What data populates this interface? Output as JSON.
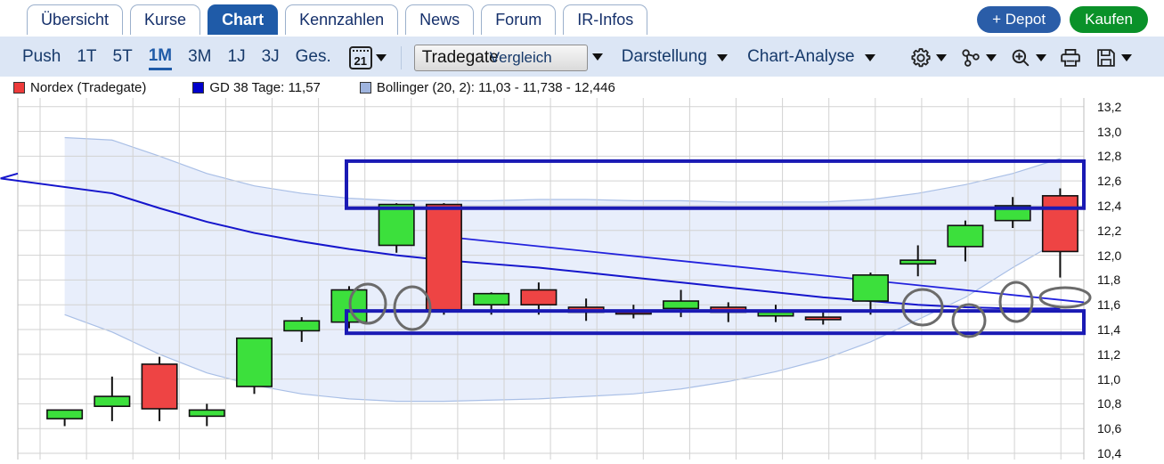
{
  "tabs": [
    {
      "label": "Übersicht",
      "active": false
    },
    {
      "label": "Kurse",
      "active": false
    },
    {
      "label": "Chart",
      "active": true
    },
    {
      "label": "Kennzahlen",
      "active": false
    },
    {
      "label": "News",
      "active": false
    },
    {
      "label": "Forum",
      "active": false
    },
    {
      "label": "IR-Infos",
      "active": false
    }
  ],
  "top_buttons": {
    "depot": "+ Depot",
    "kaufen": "Kaufen"
  },
  "toolbar": {
    "push": "Push",
    "ranges": [
      {
        "label": "1T",
        "selected": false
      },
      {
        "label": "5T",
        "selected": false
      },
      {
        "label": "1M",
        "selected": true
      },
      {
        "label": "3M",
        "selected": false
      },
      {
        "label": "1J",
        "selected": false
      },
      {
        "label": "3J",
        "selected": false
      },
      {
        "label": "Ges.",
        "selected": false
      }
    ],
    "calendar_day": "21",
    "exchange_select": "Tradegate",
    "vergleich": "Vergleich",
    "darstellung": "Darstellung",
    "chart_analyse": "Chart-Analyse",
    "icons": [
      "gear-icon",
      "share-nodes-icon",
      "zoom-in-icon",
      "printer-icon",
      "save-icon"
    ]
  },
  "legend": [
    {
      "label": "Nordex (Tradegate)",
      "color": "#ee3b3b"
    },
    {
      "label": "GD 38 Tage: 11,57",
      "color": "#0000cc"
    },
    {
      "label": "Bollinger (20, 2): 11,03 - 11,738 - 12,446",
      "color": "#9fb4de"
    }
  ],
  "chart_data": {
    "type": "candlestick",
    "title": "Nordex (Tradegate)",
    "xlabel": "",
    "ylabel": "",
    "ylim": [
      10.35,
      13.27
    ],
    "grid": true,
    "legend_position": "top",
    "y_ticks": [
      "13,2",
      "13,0",
      "12,8",
      "12,6",
      "12,4",
      "12,2",
      "12,0",
      "11,8",
      "11,6",
      "11,4",
      "11,2",
      "11,0",
      "10,8",
      "10,6",
      "10,4"
    ],
    "y_tick_values": [
      13.2,
      13.0,
      12.8,
      12.6,
      12.4,
      12.2,
      12.0,
      11.8,
      11.6,
      11.4,
      11.2,
      11.0,
      10.8,
      10.6,
      10.4
    ],
    "candles": [
      {
        "open": 10.68,
        "high": 10.68,
        "low": 10.62,
        "close": 10.75,
        "dir": "up"
      },
      {
        "open": 10.78,
        "high": 11.02,
        "low": 10.66,
        "close": 10.86,
        "dir": "up"
      },
      {
        "open": 11.12,
        "high": 11.18,
        "low": 10.66,
        "close": 10.76,
        "dir": "down"
      },
      {
        "open": 10.7,
        "high": 10.8,
        "low": 10.62,
        "close": 10.75,
        "dir": "up"
      },
      {
        "open": 10.94,
        "high": 11.1,
        "low": 10.88,
        "close": 11.33,
        "dir": "up"
      },
      {
        "open": 11.39,
        "high": 11.5,
        "low": 11.3,
        "close": 11.47,
        "dir": "up"
      },
      {
        "open": 11.46,
        "high": 11.75,
        "low": 11.41,
        "close": 11.72,
        "dir": "up"
      },
      {
        "open": 12.08,
        "high": 12.42,
        "low": 12.02,
        "close": 12.41,
        "dir": "up"
      },
      {
        "open": 11.56,
        "high": 12.42,
        "low": 11.52,
        "close": 12.41,
        "dir": "down"
      },
      {
        "open": 11.6,
        "high": 11.7,
        "low": 11.52,
        "close": 11.69,
        "dir": "up"
      },
      {
        "open": 11.6,
        "high": 11.78,
        "low": 11.52,
        "close": 11.72,
        "dir": "down"
      },
      {
        "open": 11.54,
        "high": 11.65,
        "low": 11.47,
        "close": 11.58,
        "dir": "down"
      },
      {
        "open": 11.53,
        "high": 11.6,
        "low": 11.49,
        "close": 11.54,
        "dir": "down"
      },
      {
        "open": 11.57,
        "high": 11.72,
        "low": 11.5,
        "close": 11.63,
        "dir": "up"
      },
      {
        "open": 11.54,
        "high": 11.62,
        "low": 11.46,
        "close": 11.58,
        "dir": "down"
      },
      {
        "open": 11.51,
        "high": 11.6,
        "low": 11.46,
        "close": 11.54,
        "dir": "up"
      },
      {
        "open": 11.48,
        "high": 11.54,
        "low": 11.44,
        "close": 11.5,
        "dir": "down"
      },
      {
        "open": 11.63,
        "high": 11.86,
        "low": 11.52,
        "close": 11.84,
        "dir": "up"
      },
      {
        "open": 11.93,
        "high": 12.08,
        "low": 11.83,
        "close": 11.96,
        "dir": "up"
      },
      {
        "open": 12.07,
        "high": 12.28,
        "low": 11.95,
        "close": 12.24,
        "dir": "up"
      },
      {
        "open": 12.28,
        "high": 12.47,
        "low": 12.22,
        "close": 12.4,
        "dir": "up"
      },
      {
        "open": 12.48,
        "high": 12.54,
        "low": 11.82,
        "close": 12.03,
        "dir": "down"
      }
    ],
    "overlays": {
      "gd38_label": "GD 38 Tage: 11,57",
      "bollinger_label": "Bollinger (20, 2): 11,03 - 11,738 - 12,446",
      "annotation_boxes": [
        {
          "name": "resistance-zone",
          "y_top": 12.76,
          "y_bottom": 12.38
        },
        {
          "name": "support-zone",
          "y_top": 11.55,
          "y_bottom": 11.37
        }
      ],
      "annotation_circles": 6,
      "trendline": {
        "from_y": 12.16,
        "to_y": 11.62
      }
    }
  }
}
